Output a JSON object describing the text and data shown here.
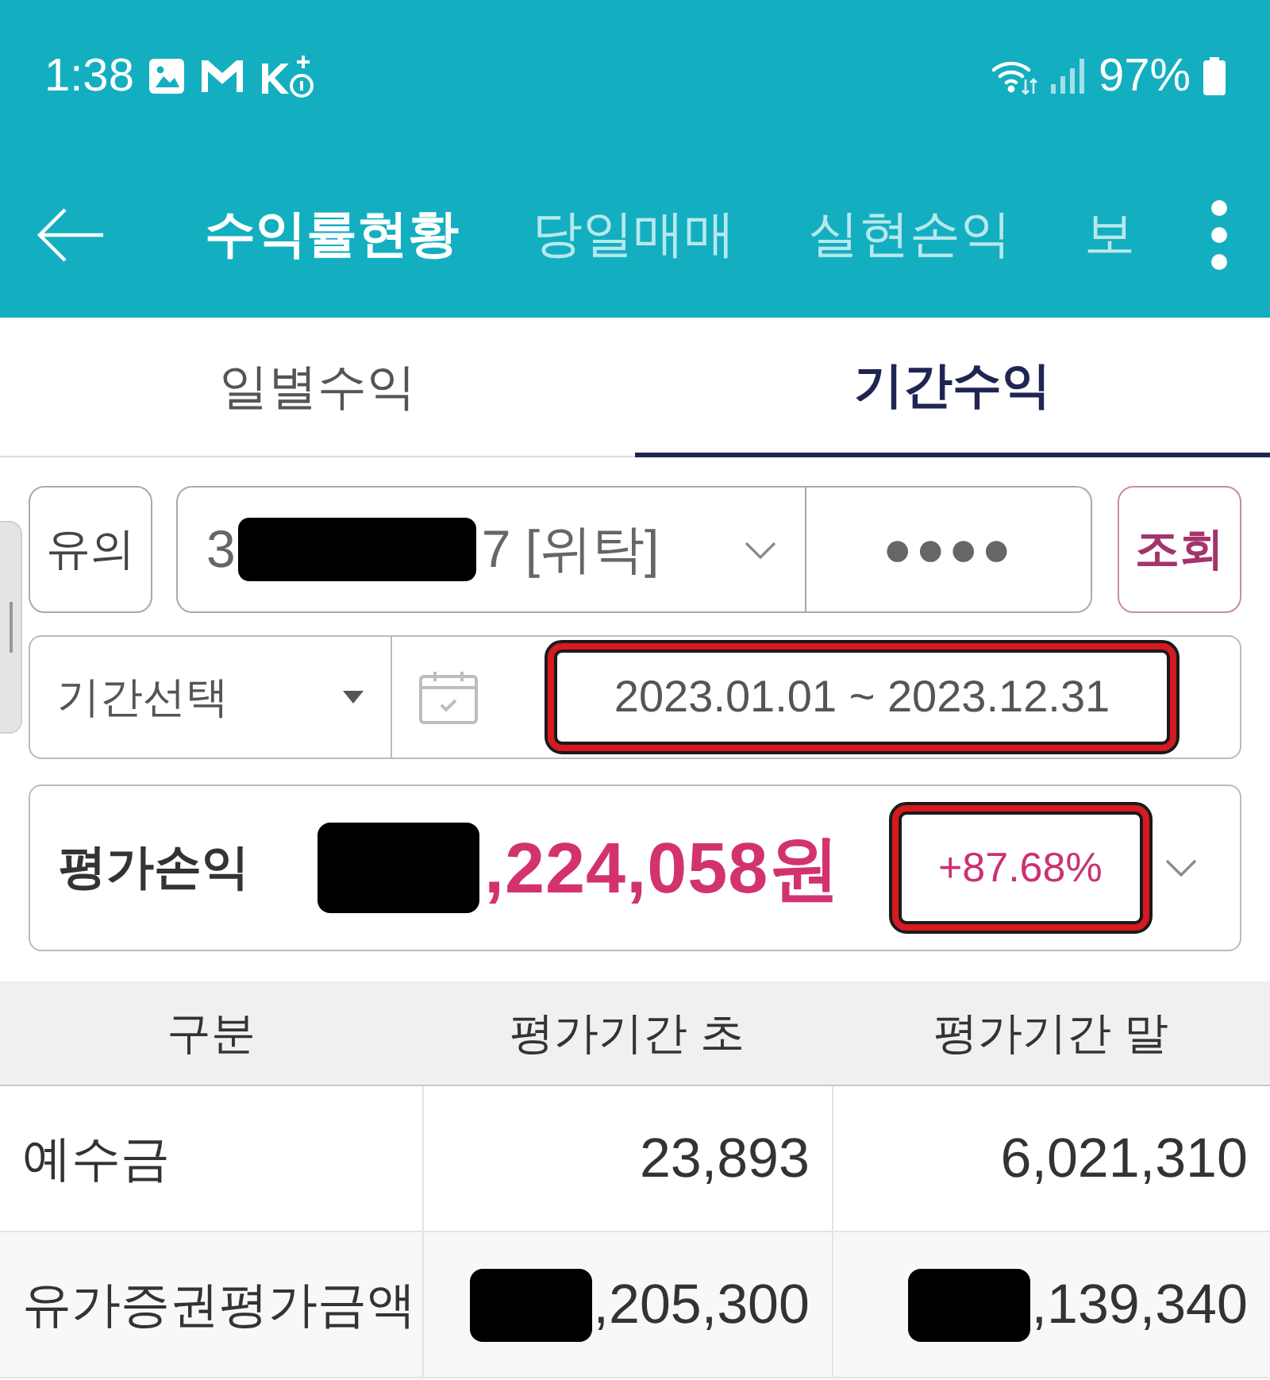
{
  "status_bar": {
    "time": "1:38",
    "battery": "97%"
  },
  "header": {
    "tabs": [
      {
        "label": "수익률현황",
        "selected": true
      },
      {
        "label": "당일매매",
        "selected": false
      },
      {
        "label": "실현손익",
        "selected": false
      },
      {
        "label": "보",
        "selected": false
      }
    ]
  },
  "sub_tabs": [
    {
      "label": "일별수익",
      "selected": false
    },
    {
      "label": "기간수익",
      "selected": true
    }
  ],
  "account_row": {
    "notice_button": "유의",
    "account": {
      "prefix": "3",
      "suffix": "7 [위탁]",
      "redacted": true
    },
    "password": "●●●●",
    "search_button": "조회"
  },
  "period_row": {
    "period_select": "기간선택",
    "date_range": {
      "text": "2023.01.01 ~ 2023.12.31",
      "highlighted": true
    }
  },
  "profit": {
    "label": "평가손익",
    "amount": {
      "text": ",224,058원",
      "redacted": true
    },
    "rate": {
      "text": "+87.68%",
      "highlighted": true
    }
  },
  "table": {
    "columns": [
      "구분",
      "평가기간 초",
      "평가기간 말"
    ],
    "rows": [
      {
        "cells": [
          {
            "text": "예수금",
            "redacted": false
          },
          {
            "text": "23,893",
            "redacted": false
          },
          {
            "text": "6,021,310",
            "redacted": false
          }
        ]
      },
      {
        "cells": [
          {
            "text": "유가증권평가금액",
            "redacted": false
          },
          {
            "text": ",205,300",
            "redacted": true
          },
          {
            "text": ",139,340",
            "redacted": true
          }
        ]
      }
    ]
  }
}
